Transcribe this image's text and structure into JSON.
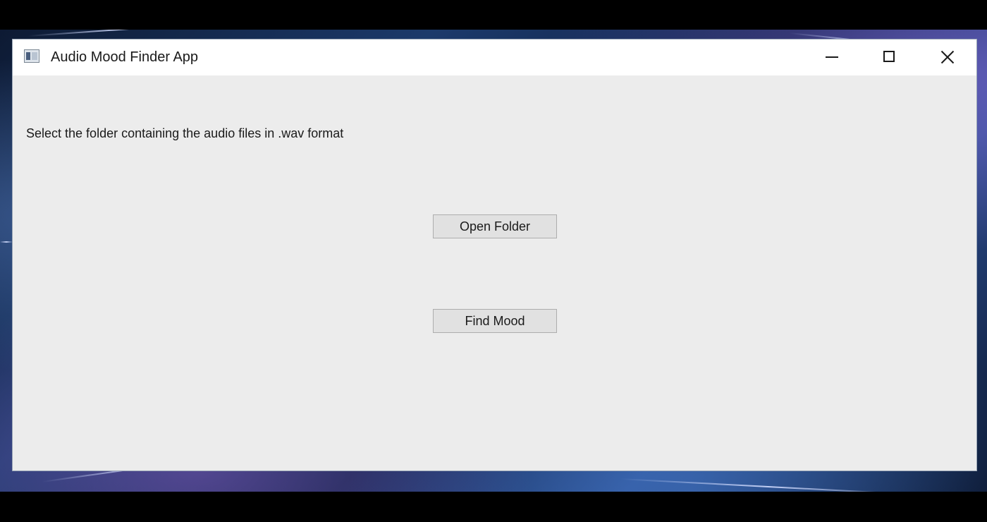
{
  "window": {
    "title": "Audio Mood Finder App",
    "icon": "app-window-icon",
    "controls": {
      "minimize": "minimize-icon",
      "maximize": "maximize-icon",
      "close": "close-icon"
    }
  },
  "main": {
    "instruction": "Select the folder containing the audio files in .wav format",
    "open_folder_label": "Open Folder",
    "find_mood_label": "Find Mood"
  },
  "colors": {
    "window_bg": "#ececec",
    "titlebar_bg": "#ffffff",
    "button_bg": "#e1e1e1",
    "button_border": "#adadad"
  }
}
